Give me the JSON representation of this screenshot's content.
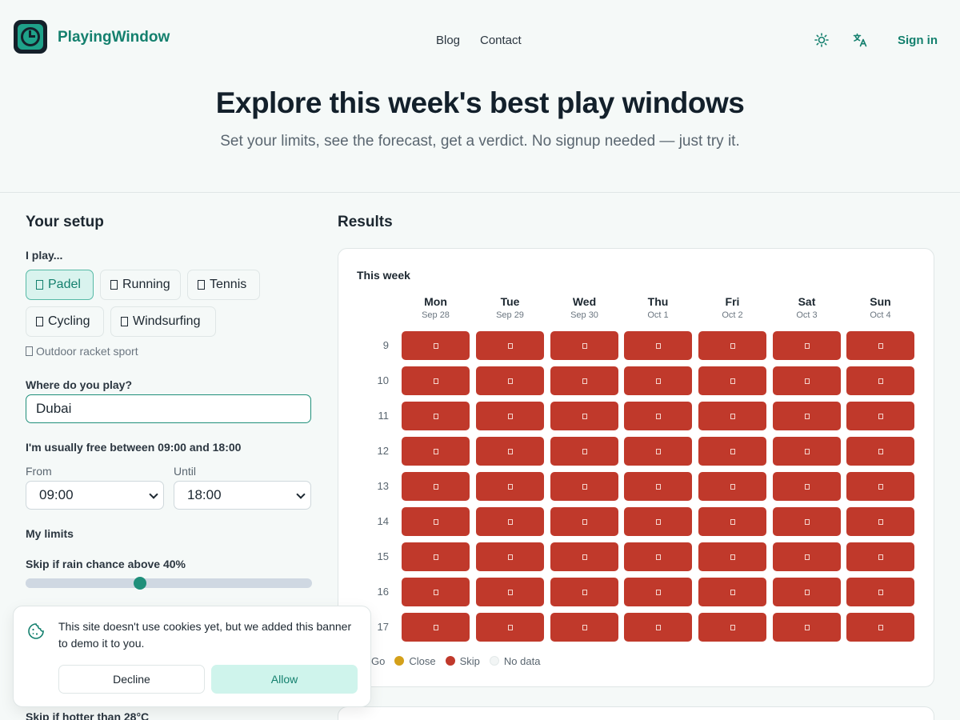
{
  "header": {
    "brand": "PlayingWindow",
    "nav": [
      "Blog",
      "Contact"
    ],
    "sign_in": "Sign in"
  },
  "hero": {
    "title": "Explore this week's best play windows",
    "subtitle": "Set your limits, see the forecast, get a verdict. No signup needed — just try it."
  },
  "setup": {
    "heading": "Your setup",
    "play_label": "I play...",
    "sports": [
      {
        "label": "Padel",
        "selected": true
      },
      {
        "label": "Running",
        "selected": false
      },
      {
        "label": "Tennis",
        "selected": false
      },
      {
        "label": "Cycling",
        "selected": false
      },
      {
        "label": "Windsurfing",
        "selected": false
      }
    ],
    "sport_hint": "Outdoor racket sport",
    "location_label": "Where do you play?",
    "location_value": "Dubai",
    "free_label": "I'm usually free between 09:00 and 18:00",
    "from_label": "From",
    "from_value": "09:00",
    "until_label": "Until",
    "until_value": "18:00",
    "limits_label": "My limits",
    "rain_label": "Skip if rain chance above 40%",
    "rain_value_percent": 40,
    "heat_label": "Skip if hotter than 28°C"
  },
  "results": {
    "heading": "Results",
    "week_label": "This week",
    "days": [
      {
        "name": "Mon",
        "date": "Sep 28"
      },
      {
        "name": "Tue",
        "date": "Sep 29"
      },
      {
        "name": "Wed",
        "date": "Sep 30"
      },
      {
        "name": "Thu",
        "date": "Oct 1"
      },
      {
        "name": "Fri",
        "date": "Oct 2"
      },
      {
        "name": "Sat",
        "date": "Oct 3"
      },
      {
        "name": "Sun",
        "date": "Oct 4"
      }
    ],
    "hours": [
      "9",
      "10",
      "11",
      "12",
      "13",
      "14",
      "15",
      "16",
      "17"
    ],
    "verdict_all": "skip",
    "legend": [
      {
        "label": "Go",
        "color": "#1f8f7a"
      },
      {
        "label": "Close",
        "color": "#d4a01a"
      },
      {
        "label": "Skip",
        "color": "#c0392b"
      },
      {
        "label": "No data",
        "color": "#f2f5f5"
      }
    ],
    "skip_color": "#c0392b"
  },
  "cookie": {
    "text": "This site doesn't use cookies yet, but we added this banner to demo it to you.",
    "decline": "Decline",
    "allow": "Allow"
  },
  "colors": {
    "accent": "#1f8f7a",
    "brand_text": "#14806e"
  }
}
